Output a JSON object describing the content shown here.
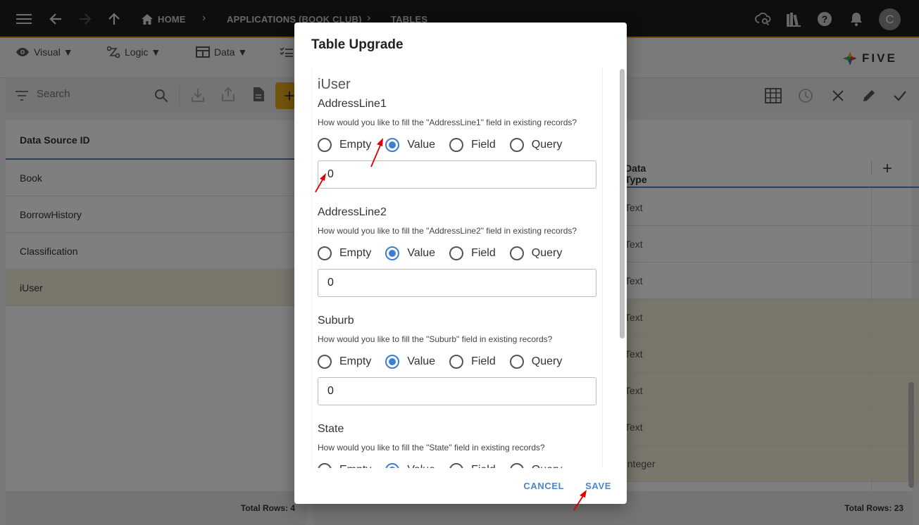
{
  "topbar": {
    "breadcrumb": [
      "HOME",
      "APPLICATIONS (BOOK CLUB)",
      "TABLES"
    ],
    "avatar_initial": "C"
  },
  "menubar": {
    "items": [
      {
        "label": "Visual ▼"
      },
      {
        "label": "Logic ▼"
      },
      {
        "label": "Data ▼"
      }
    ],
    "brand": "FIVE"
  },
  "left": {
    "search_placeholder": "Search",
    "add_label": "+",
    "column_header": "Data Source ID",
    "rows": [
      "Book",
      "BorrowHistory",
      "Classification",
      "iUser"
    ],
    "selected_index": 3,
    "total_rows": "Total Rows: 4"
  },
  "right": {
    "column_header": "Data Type",
    "add_label": "+",
    "rows": [
      "Text",
      "Text",
      "Text",
      "Text",
      "Text",
      "Text",
      "Text",
      "Integer"
    ],
    "total_rows": "Total Rows: 23"
  },
  "dialog": {
    "title": "Table Upgrade",
    "entity": "iUser",
    "radio_options": [
      "Empty",
      "Value",
      "Field",
      "Query"
    ],
    "fields": [
      {
        "name": "AddressLine1",
        "question": "How would you like to fill the \"AddressLine1\" field in existing records?",
        "selected": "Value",
        "value": "0"
      },
      {
        "name": "AddressLine2",
        "question": "How would you like to fill the \"AddressLine2\" field in existing records?",
        "selected": "Value",
        "value": "0"
      },
      {
        "name": "Suburb",
        "question": "How would you like to fill the \"Suburb\" field in existing records?",
        "selected": "Value",
        "value": "0"
      },
      {
        "name": "State",
        "question": "How would you like to fill the \"State\" field in existing records?",
        "selected": "Value",
        "value": ""
      }
    ],
    "cancel_label": "CANCEL",
    "save_label": "SAVE"
  },
  "colors": {
    "accent": "#e6a817",
    "primary": "#4a86c8",
    "radio_on": "#3a7fd5",
    "annotation_arrow": "#e00000"
  }
}
